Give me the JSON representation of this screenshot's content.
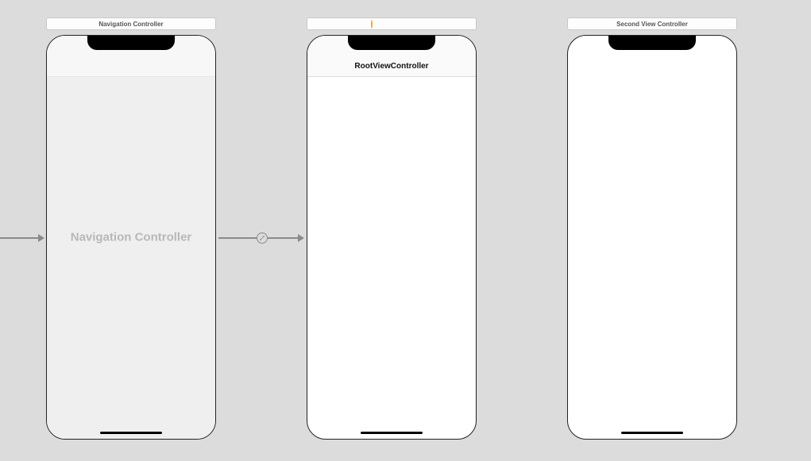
{
  "scenes": {
    "nav": {
      "title": "Navigation Controller",
      "placeholder": "Navigation Controller"
    },
    "root": {
      "navbar_title": "RootViewController"
    },
    "second": {
      "title": "Second View Controller"
    }
  }
}
